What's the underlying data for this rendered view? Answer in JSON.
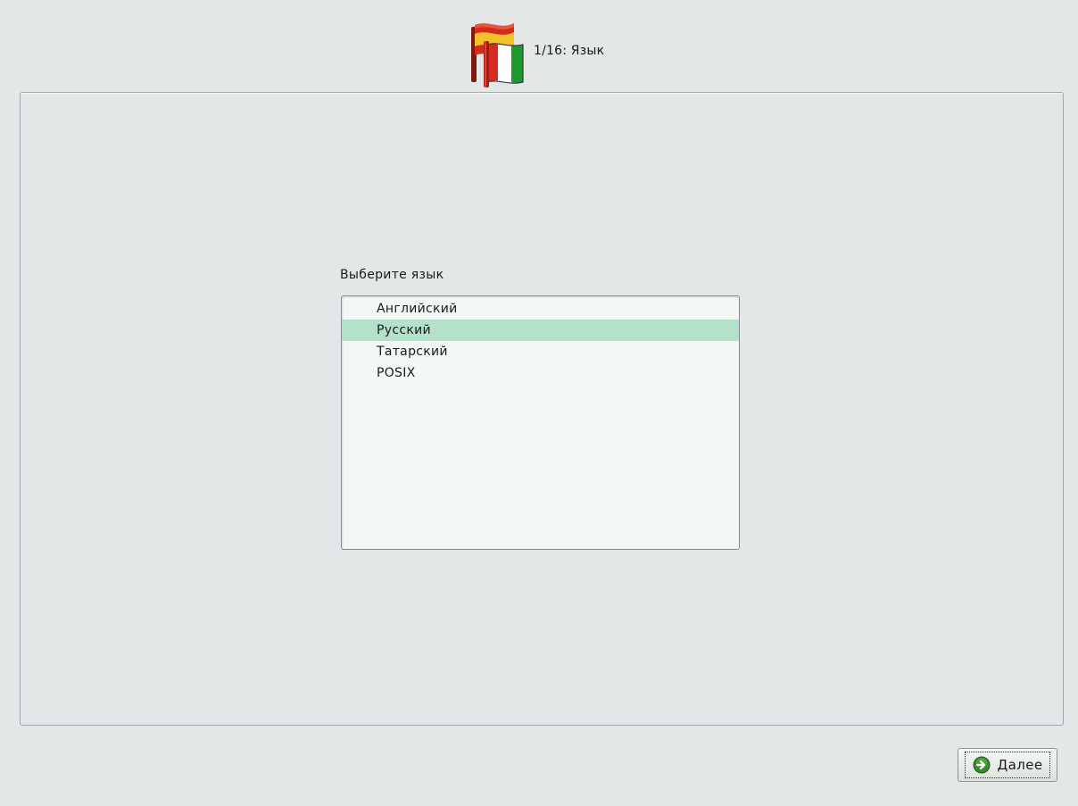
{
  "header": {
    "icon": "flag-icon",
    "step_title": "1/16: Язык"
  },
  "language_selection": {
    "label": "Выберите язык",
    "items": [
      {
        "label": "Английский",
        "selected": false
      },
      {
        "label": "Русский",
        "selected": true
      },
      {
        "label": "Татарский",
        "selected": false
      },
      {
        "label": "POSIX",
        "selected": false
      }
    ],
    "selected_color": "#b3e1c9"
  },
  "footer": {
    "next_button": {
      "icon": "arrow-right-circle-icon",
      "label": "Далее",
      "icon_color": "#3a8a2e"
    }
  }
}
